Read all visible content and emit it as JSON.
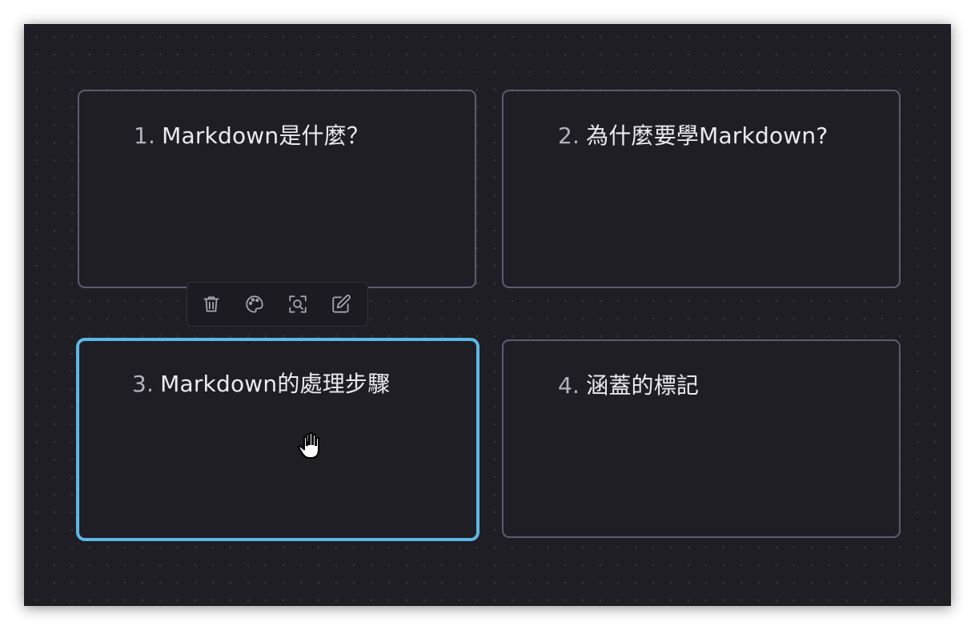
{
  "canvas": {
    "cards": [
      {
        "number": "1.",
        "title": "Markdown是什麼？",
        "selected": false
      },
      {
        "number": "2.",
        "title": "為什麼要學Markdown?",
        "selected": false
      },
      {
        "number": "3.",
        "title": "Markdown的處理步驟",
        "selected": true
      },
      {
        "number": "4.",
        "title": "涵蓋的標記",
        "selected": false
      }
    ],
    "toolbar": {
      "buttons": [
        {
          "icon": "trash-icon"
        },
        {
          "icon": "palette-icon"
        },
        {
          "icon": "zoom-to-fit-icon"
        },
        {
          "icon": "edit-icon"
        }
      ]
    },
    "cursor": "grab-hand-icon"
  },
  "colors": {
    "background": "#1f1e24",
    "card_border": "#5c5b74",
    "selected_border": "#5cb8e6",
    "text": "#ececf0",
    "number_text": "#b4b3bb",
    "icon": "#aaa9b2"
  }
}
